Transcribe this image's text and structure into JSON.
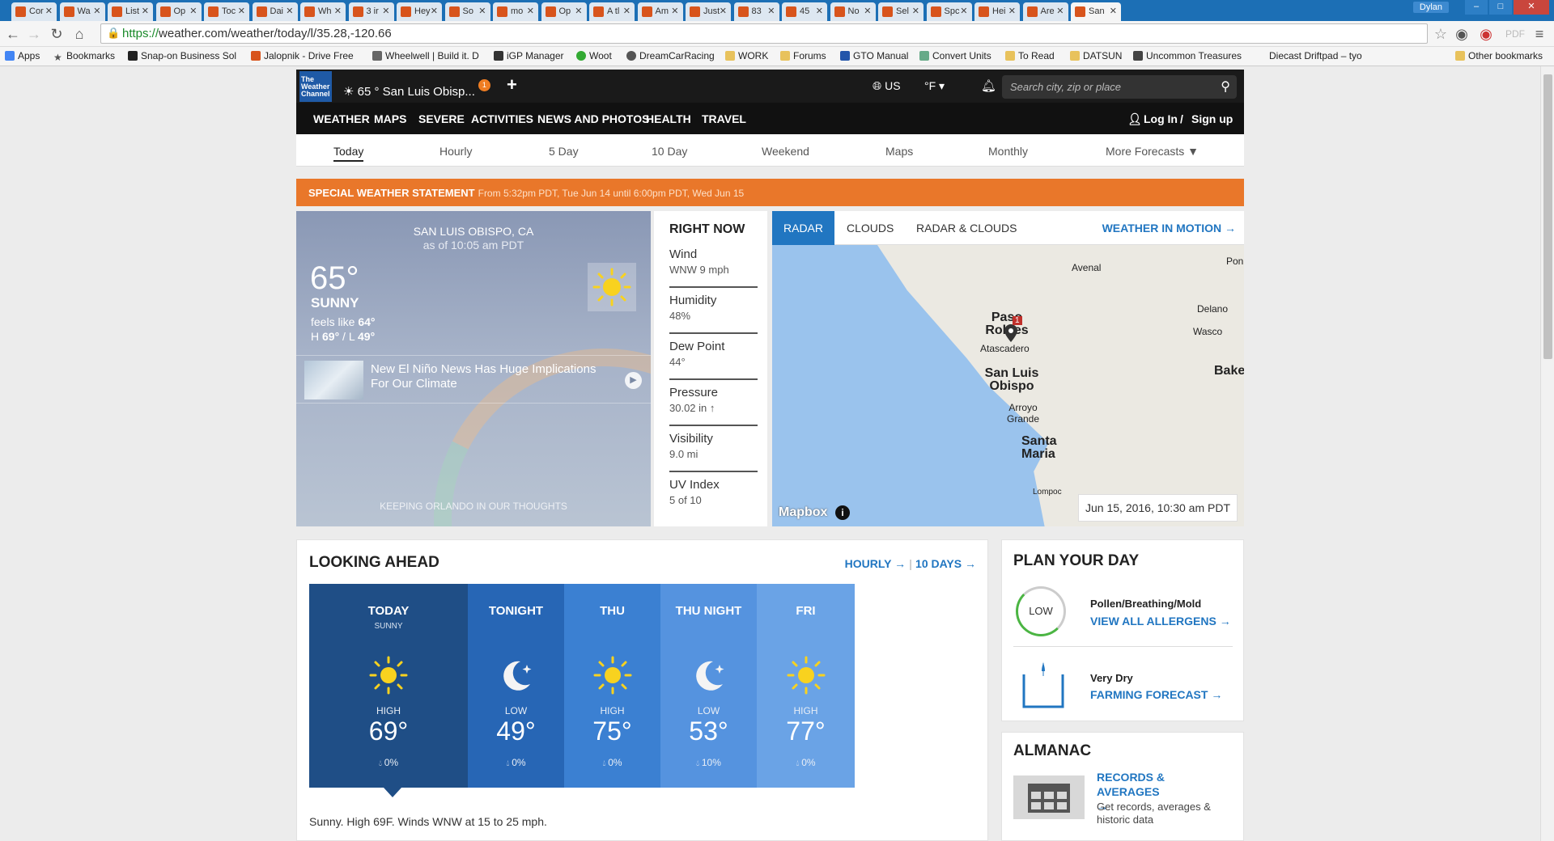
{
  "browser": {
    "tabs": [
      {
        "label": "Cor"
      },
      {
        "label": "Wa"
      },
      {
        "label": "List"
      },
      {
        "label": "Op"
      },
      {
        "label": "Toc"
      },
      {
        "label": "Dai"
      },
      {
        "label": "Wh"
      },
      {
        "label": "3 ir"
      },
      {
        "label": "Hey"
      },
      {
        "label": "So"
      },
      {
        "label": "mo"
      },
      {
        "label": "Op"
      },
      {
        "label": "A tl"
      },
      {
        "label": "Am"
      },
      {
        "label": "Just"
      },
      {
        "label": "83"
      },
      {
        "label": "45"
      },
      {
        "label": "No"
      },
      {
        "label": "Sel"
      },
      {
        "label": "Spc"
      },
      {
        "label": "Hei"
      },
      {
        "label": "Are"
      },
      {
        "label": "San"
      }
    ],
    "user": "Dylan",
    "url_scheme": "https://",
    "url_rest": "weather.com/weather/today/l/35.28,-120.66",
    "bookmarks": [
      "Apps",
      "Bookmarks",
      "Snap-on Business Sol",
      "Jalopnik - Drive Free",
      "Wheelwell | Build it. D",
      "iGP Manager",
      "Woot",
      "DreamCarRacing",
      "WORK",
      "Forums",
      "GTO Manual",
      "Convert Units",
      "To Read",
      "DATSUN",
      "Uncommon Treasures",
      "Diecast Driftpad – tyo",
      "Other bookmarks"
    ]
  },
  "header": {
    "logo": "The Weather Channel",
    "location": "65 ° San Luis Obisp...",
    "notif_count": "1",
    "region": "US",
    "units": "°F",
    "search_placeholder": "Search city, zip or place",
    "nav": [
      "WEATHER",
      "MAPS",
      "SEVERE",
      "ACTIVITIES",
      "NEWS AND PHOTOS",
      "HEALTH",
      "TRAVEL"
    ],
    "login": "Log In",
    "signup": "Sign up",
    "subnav": [
      "Today",
      "Hourly",
      "5 Day",
      "10 Day",
      "Weekend",
      "Maps",
      "Monthly",
      "More Forecasts"
    ]
  },
  "alert": {
    "title": "SPECIAL WEATHER STATEMENT",
    "detail": "From 5:32pm PDT, Tue Jun 14 until 6:00pm PDT, Wed Jun 15"
  },
  "current": {
    "location": "SAN LUIS OBISPO, CA",
    "as_of": "as of 10:05 am PDT",
    "temp": "65°",
    "phrase": "SUNNY",
    "feels_label": "feels like",
    "feels": "64°",
    "hl_h": "69°",
    "hl_l": "49°",
    "news_headline": "New El Niño News Has Huge Implications For Our Climate",
    "footer": "KEEPING ORLANDO IN OUR THOUGHTS"
  },
  "right_now": {
    "title": "RIGHT NOW",
    "items": [
      {
        "label": "Wind",
        "value": "WNW 9 mph"
      },
      {
        "label": "Humidity",
        "value": "48%"
      },
      {
        "label": "Dew Point",
        "value": "44°"
      },
      {
        "label": "Pressure",
        "value": "30.02 in"
      },
      {
        "label": "Visibility",
        "value": "9.0 mi"
      },
      {
        "label": "UV Index",
        "value": "5 of 10"
      }
    ]
  },
  "radar": {
    "tabs": [
      "RADAR",
      "CLOUDS",
      "RADAR & CLOUDS"
    ],
    "motion_link": "WEATHER IN MOTION →",
    "places": [
      "Avenal",
      "Pon",
      "Delano",
      "Paso Robles",
      "Wasco",
      "Atascadero",
      "San Luis Obispo",
      "Bake",
      "Arroyo Grande",
      "Santa Maria",
      "Lompoc"
    ],
    "pin_badge": "1",
    "attribution": "Mapbox",
    "timestamp": "Jun 15, 2016, 10:30 am PDT"
  },
  "looking_ahead": {
    "title": "LOOKING AHEAD",
    "hourly_link": "HOURLY →",
    "tendays_link": "10 DAYS →",
    "days": [
      {
        "name": "TODAY",
        "phrase": "SUNNY",
        "icon": "sun-icon",
        "hl": "HIGH",
        "temp": "69°",
        "precip": "0%",
        "color": "#1f4e86"
      },
      {
        "name": "TONIGHT",
        "phrase": "",
        "icon": "moon-icon",
        "hl": "LOW",
        "temp": "49°",
        "precip": "0%",
        "color": "#2766b5"
      },
      {
        "name": "THU",
        "phrase": "",
        "icon": "sun-icon",
        "hl": "HIGH",
        "temp": "75°",
        "precip": "0%",
        "color": "#3b80d2"
      },
      {
        "name": "THU NIGHT",
        "phrase": "",
        "icon": "moon-icon",
        "hl": "LOW",
        "temp": "53°",
        "precip": "10%",
        "color": "#5593df"
      },
      {
        "name": "FRI",
        "phrase": "",
        "icon": "sun-icon",
        "hl": "HIGH",
        "temp": "77°",
        "precip": "0%",
        "color": "#6aa3e6"
      }
    ],
    "description": "Sunny. High 69F. Winds WNW at 15 to 25 mph."
  },
  "plan": {
    "title": "PLAN YOUR DAY",
    "allergy_level": "LOW",
    "allergy_title": "Pollen/Breathing/Mold",
    "allergy_link": "VIEW ALL ALLERGENS →",
    "farm_title": "Very Dry",
    "farm_link": "FARMING FORECAST →"
  },
  "almanac": {
    "title": "ALMANAC",
    "link": "RECORDS & AVERAGES →",
    "desc": "Get records, averages & historic data"
  }
}
